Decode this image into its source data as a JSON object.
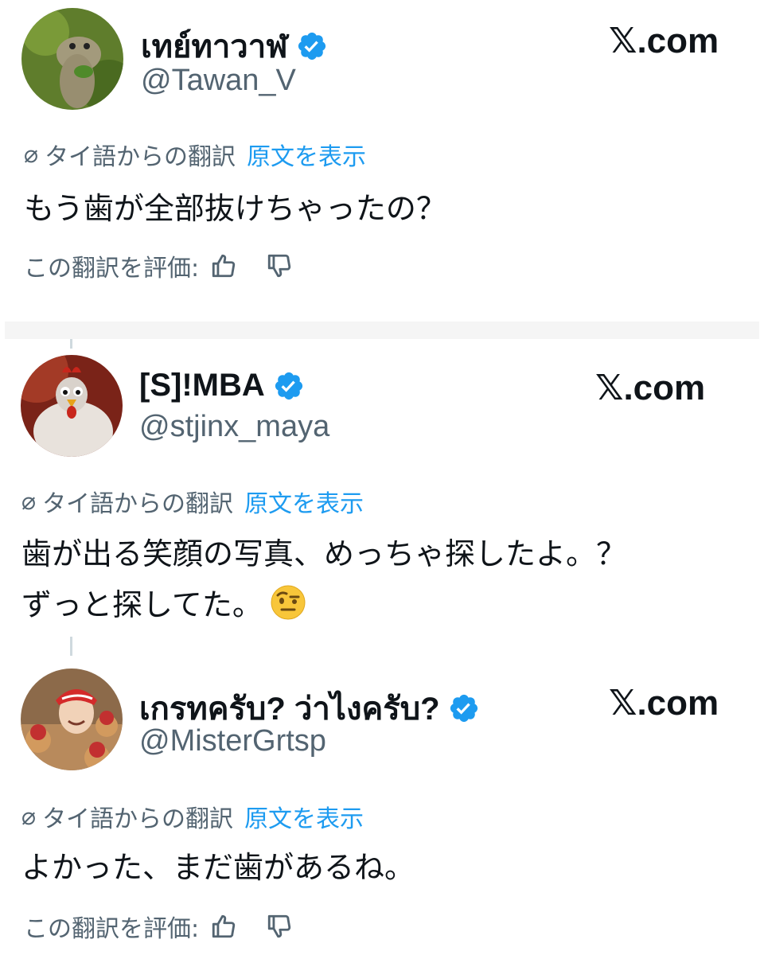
{
  "translate_note": "タイ語からの翻訳",
  "show_original": "原文を表示",
  "rate_label": "この翻訳を評価:",
  "site": "𝕏.com",
  "posts": [
    {
      "name": "เทย์ทาวาฬ",
      "handle": "@Tawan_V",
      "text_lines": [
        "もう歯が全部抜けちゃったの？"
      ]
    },
    {
      "name": "[S]!MBA",
      "handle": "@stjinx_maya",
      "text_lines": [
        "歯が出る笑顔の写真、めっちゃ探したよ。？",
        "ずっと探してた。"
      ],
      "emoji": "face-with-raised-eyebrow"
    },
    {
      "name": "เกรทครับ? ว่าไงครับ?",
      "handle": "@MisterGrtsp",
      "text_lines": [
        "よかった、まだ歯があるね。"
      ]
    }
  ],
  "colors": {
    "link_blue": "#1d9bf0",
    "verified_blue": "#1d9bf0",
    "secondary_text": "#536471",
    "primary_text": "#0f1419"
  },
  "icons": [
    "verified-badge-icon",
    "translate-icon",
    "thumbs-up-icon",
    "thumbs-down-icon"
  ]
}
